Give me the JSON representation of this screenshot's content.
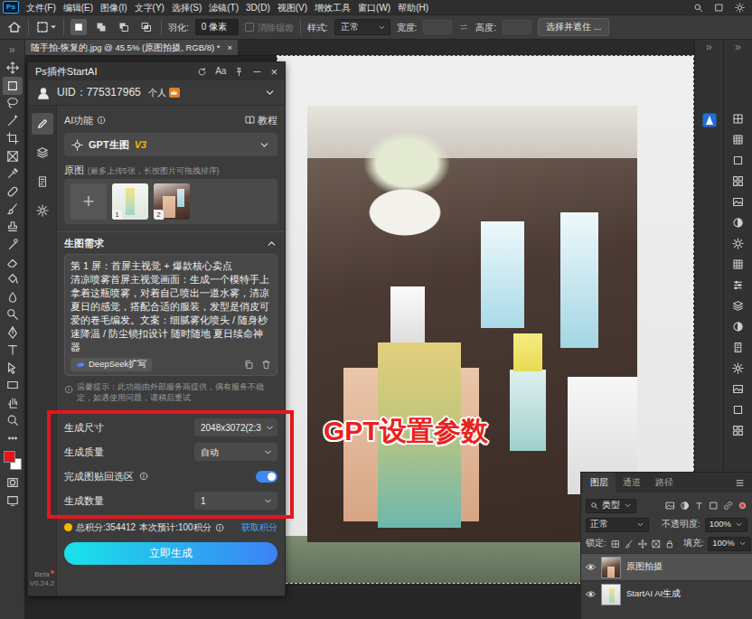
{
  "menu_bar": {
    "logo": "Ps",
    "items": [
      "文件(F)",
      "编辑(E)",
      "图像(I)",
      "文字(Y)",
      "选择(S)",
      "滤镜(T)",
      "3D(D)",
      "视图(V)",
      "增效工具",
      "窗口(W)",
      "帮助(H)"
    ]
  },
  "options_bar": {
    "selection_modes": [
      {
        "selected": true
      },
      {
        "selected": false
      },
      {
        "selected": false
      },
      {
        "selected": false
      }
    ],
    "feather_label": "羽化:",
    "feather_value": "0 像素",
    "antialias": {
      "label": "消除锯齿",
      "disabled": true
    },
    "style_label": "样式:",
    "style_value": "正常",
    "width_label": "宽度:",
    "height_label": "高度:",
    "mask_button": "选择并遮住 ..."
  },
  "toolbar": {
    "tools": [
      {
        "selected": false
      },
      {
        "selected": true
      },
      {
        "selected": false
      },
      {
        "selected": false
      },
      {
        "selected": false
      },
      {
        "selected": false
      },
      {
        "selected": false
      },
      {
        "selected": false
      },
      {
        "selected": false
      },
      {
        "selected": false
      },
      {
        "selected": false
      },
      {
        "selected": false
      },
      {
        "selected": false
      },
      {
        "selected": false
      },
      {
        "selected": false
      },
      {
        "selected": false
      },
      {
        "selected": false
      },
      {
        "selected": false
      },
      {
        "selected": false
      },
      {
        "selected": false
      },
      {
        "selected": false
      },
      {
        "selected": false
      },
      {
        "selected": false
      },
      {
        "selected": false
      }
    ],
    "foreground_color": "#e8141b",
    "background_color": "#ffffff"
  },
  "document_tab": {
    "title": "随手拍-恢复的.jpg @ 45.5% (原图拍摄, RGB/8) *",
    "close": "×"
  },
  "plugin": {
    "title": "Ps插件StartAI",
    "font_button": "Aa",
    "close": "×",
    "uid": "UID：775317965",
    "account_type": "个人",
    "nav": [
      {
        "selected": true
      },
      {
        "selected": false
      },
      {
        "selected": false
      },
      {
        "selected": false
      }
    ],
    "version_label": "Beta",
    "version": "V0.24.2",
    "feature_label": "AI功能",
    "tutorial": "教程",
    "model": {
      "name": "GPT生图",
      "version": "V3"
    },
    "source_label": "原图",
    "source_hint": "(最多上传5张，长按图片可拖拽排序)",
    "add_button": "+",
    "images": [
      {
        "index": "1"
      },
      {
        "index": "2"
      }
    ],
    "prompt_header": "生图需求",
    "prompt_expanded": true,
    "prompt": "第 1 屏：首屏主视觉 + 爆款核心卖点\n清凉喷雾首屏主视觉画面：生成一个模特手上拿着这瓶喷雾，对着自己喷出一道水雾，清凉夏日的感觉，搭配合适的服装，发型是俏皮可爱的卷毛编发。文案：细腻雾化喷头 / 随身秒速降温 / 防尘锁扣设计 随时随地 夏日续命神器",
    "expand_button": "DeepSeek扩写",
    "notice": "温馨提示：此功能由外部服务商提供，偶有服务不稳定，如遇使用问题，请稍后重试",
    "params": [
      {
        "kind": "select",
        "label": "生成尺寸",
        "value": "2048x3072(2:3"
      },
      {
        "kind": "select",
        "label": "生成质量",
        "value": "自动"
      },
      {
        "kind": "toggle",
        "label": "完成图贴回选区",
        "on": true
      },
      {
        "kind": "select",
        "label": "生成数量",
        "value": "1"
      }
    ],
    "credits_total": "总积分:354412",
    "credits_estimate": "本次预计:100积分",
    "get_credits": "获取积分",
    "generate": "立即生成"
  },
  "annotation": {
    "text": "GPT设置参数"
  },
  "layers_panel": {
    "tabs": [
      {
        "label": "图层",
        "selected": true
      },
      {
        "label": "通道",
        "selected": false
      },
      {
        "label": "路径",
        "selected": false
      }
    ],
    "filter": "类型",
    "blend_mode": "正常",
    "opacity_label": "不透明度:",
    "opacity": "100%",
    "lock_label": "锁定:",
    "fill_label": "填充:",
    "fill": "100%",
    "layers": [
      {
        "name": "原图拍摄",
        "selected": true,
        "visible": true
      },
      {
        "name": "StartAI AI生成",
        "selected": false,
        "visible": true
      }
    ]
  }
}
